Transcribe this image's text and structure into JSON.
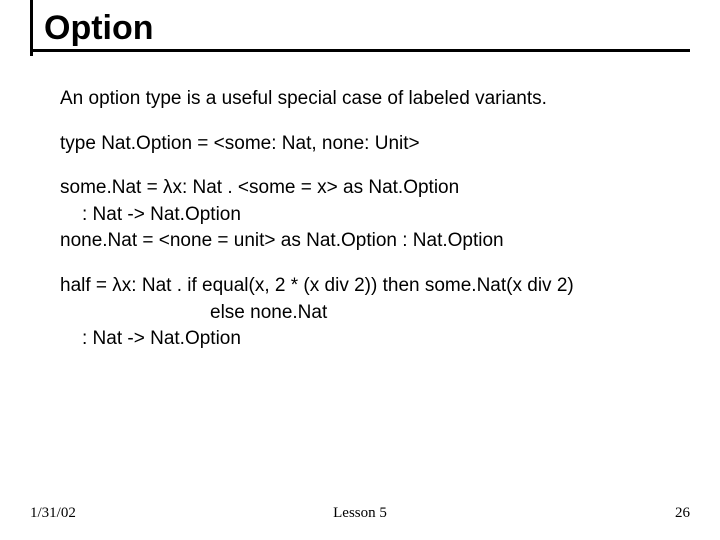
{
  "title": "Option",
  "intro": "An option type is a useful special case of labeled variants.",
  "typedef": "type Nat.Option = <some: Nat, none: Unit>",
  "someNat_line1": "some.Nat = λx: Nat . <some = x> as Nat.Option",
  "someNat_line2": ": Nat -> Nat.Option",
  "noneNat_line": "none.Nat = <none = unit> as Nat.Option   :  Nat.Option",
  "half_line1": "half = λx: Nat . if equal(x, 2 * (x div 2)) then some.Nat(x div 2)",
  "half_line2": "else none.Nat",
  "half_line3": ": Nat -> Nat.Option",
  "footer": {
    "date": "1/31/02",
    "lesson": "Lesson 5",
    "page": "26"
  }
}
